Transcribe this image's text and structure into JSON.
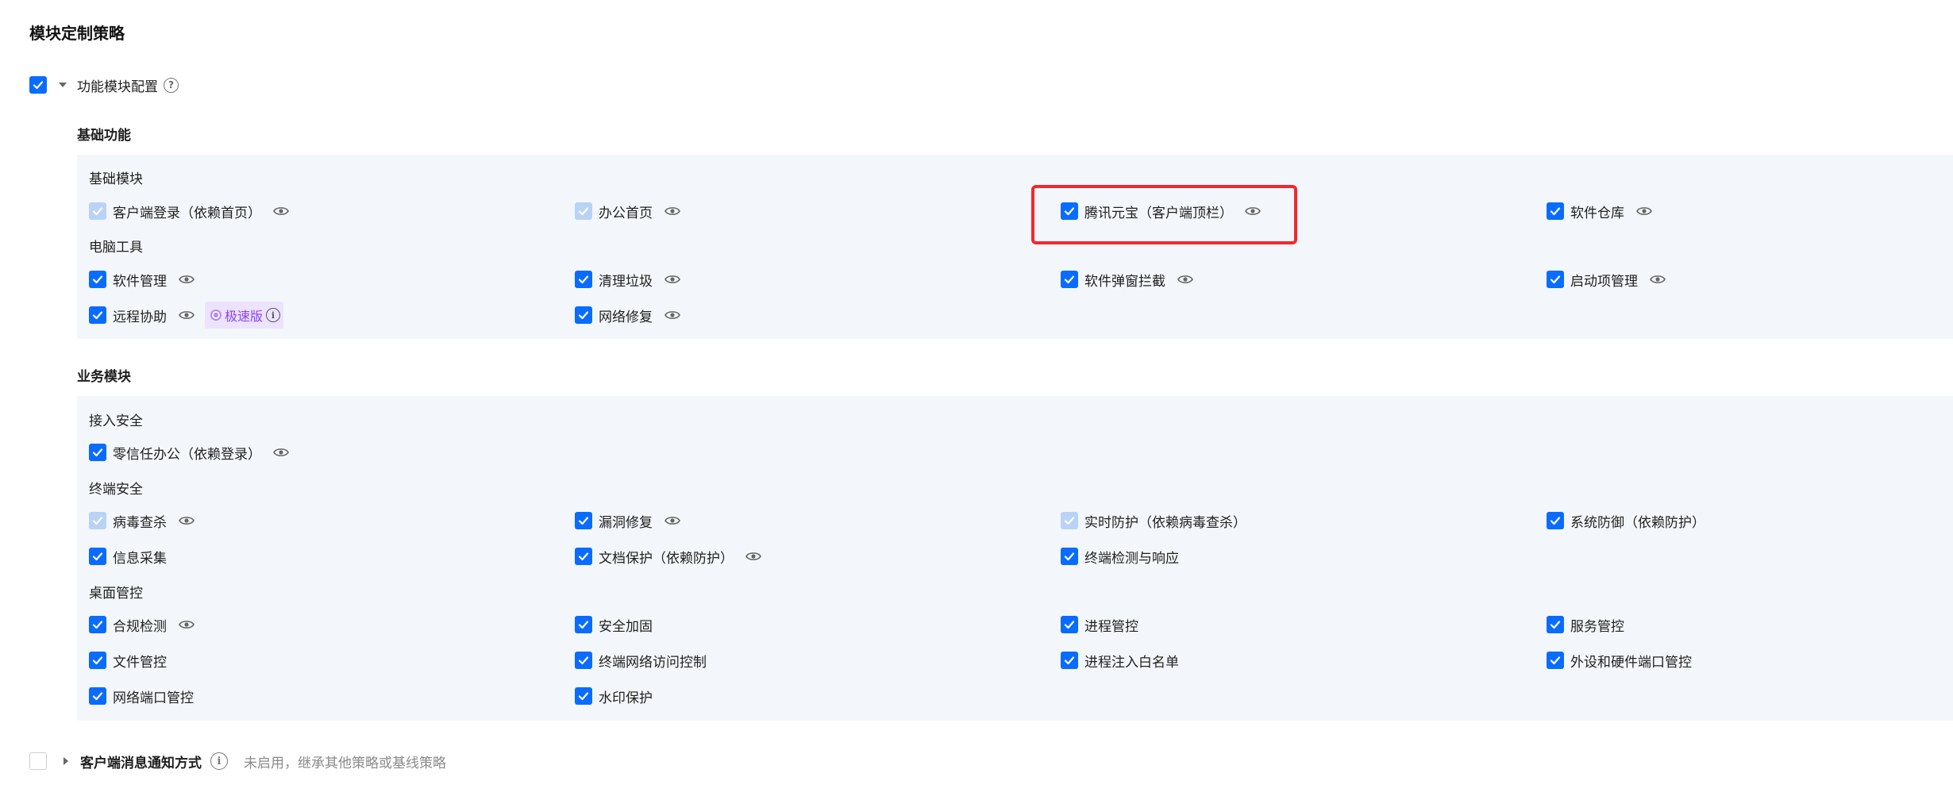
{
  "page_title": "模块定制策略",
  "feature_config": {
    "label": "功能模块配置",
    "help_glyph": "?",
    "checked": true
  },
  "basic": {
    "heading": "基础功能",
    "groups": [
      {
        "heading": "基础模块",
        "items": [
          {
            "label": "客户端登录（依赖首页）",
            "state": "checked-disabled",
            "eye": true
          },
          {
            "label": "办公首页",
            "state": "checked-disabled",
            "eye": true
          },
          {
            "label": "腾讯元宝（客户端顶栏）",
            "state": "checked",
            "eye": true,
            "highlighted": true
          },
          {
            "label": "软件仓库",
            "state": "checked",
            "eye": true
          }
        ]
      },
      {
        "heading": "电脑工具",
        "items": [
          {
            "label": "软件管理",
            "state": "checked",
            "eye": true
          },
          {
            "label": "清理垃圾",
            "state": "checked",
            "eye": true
          },
          {
            "label": "软件弹窗拦截",
            "state": "checked",
            "eye": true
          },
          {
            "label": "启动项管理",
            "state": "checked",
            "eye": true
          },
          {
            "label": "远程协助",
            "state": "checked",
            "eye": true,
            "badge": "极速版"
          },
          {
            "label": "网络修复",
            "state": "checked",
            "eye": true
          }
        ]
      }
    ]
  },
  "business": {
    "heading": "业务模块",
    "groups": [
      {
        "heading": "接入安全",
        "items": [
          {
            "label": "零信任办公（依赖登录）",
            "state": "checked",
            "eye": true
          }
        ]
      },
      {
        "heading": "终端安全",
        "items": [
          {
            "label": "病毒查杀",
            "state": "checked-disabled",
            "eye": true
          },
          {
            "label": "漏洞修复",
            "state": "checked",
            "eye": true
          },
          {
            "label": "实时防护（依赖病毒查杀）",
            "state": "checked-disabled",
            "eye": false
          },
          {
            "label": "系统防御（依赖防护）",
            "state": "checked",
            "eye": false
          },
          {
            "label": "信息采集",
            "state": "checked",
            "eye": false
          },
          {
            "label": "文档保护（依赖防护）",
            "state": "checked",
            "eye": true
          },
          {
            "label": "终端检测与响应",
            "state": "checked",
            "eye": false
          }
        ]
      },
      {
        "heading": "桌面管控",
        "items": [
          {
            "label": "合规检测",
            "state": "checked",
            "eye": true
          },
          {
            "label": "安全加固",
            "state": "checked",
            "eye": false
          },
          {
            "label": "进程管控",
            "state": "checked",
            "eye": false
          },
          {
            "label": "服务管控",
            "state": "checked",
            "eye": false
          },
          {
            "label": "文件管控",
            "state": "checked",
            "eye": false
          },
          {
            "label": "终端网络访问控制",
            "state": "checked",
            "eye": false
          },
          {
            "label": "进程注入白名单",
            "state": "checked",
            "eye": false
          },
          {
            "label": "外设和硬件端口管控",
            "state": "checked",
            "eye": false
          },
          {
            "label": "网络端口管控",
            "state": "checked",
            "eye": false
          },
          {
            "label": "水印保护",
            "state": "checked",
            "eye": false
          }
        ]
      }
    ]
  },
  "client_notify": {
    "label": "客户端消息通知方式",
    "info_glyph": "i",
    "status": "未启用，继承其他策略或基线策略",
    "checked": false
  },
  "colors": {
    "accent": "#0a6cff",
    "disabled_check": "#b9d3f7",
    "panel_bg": "#f3f7fb",
    "highlight_border": "#f0292e",
    "badge_bg": "#ece3ff",
    "badge_text": "#8a45e8"
  }
}
